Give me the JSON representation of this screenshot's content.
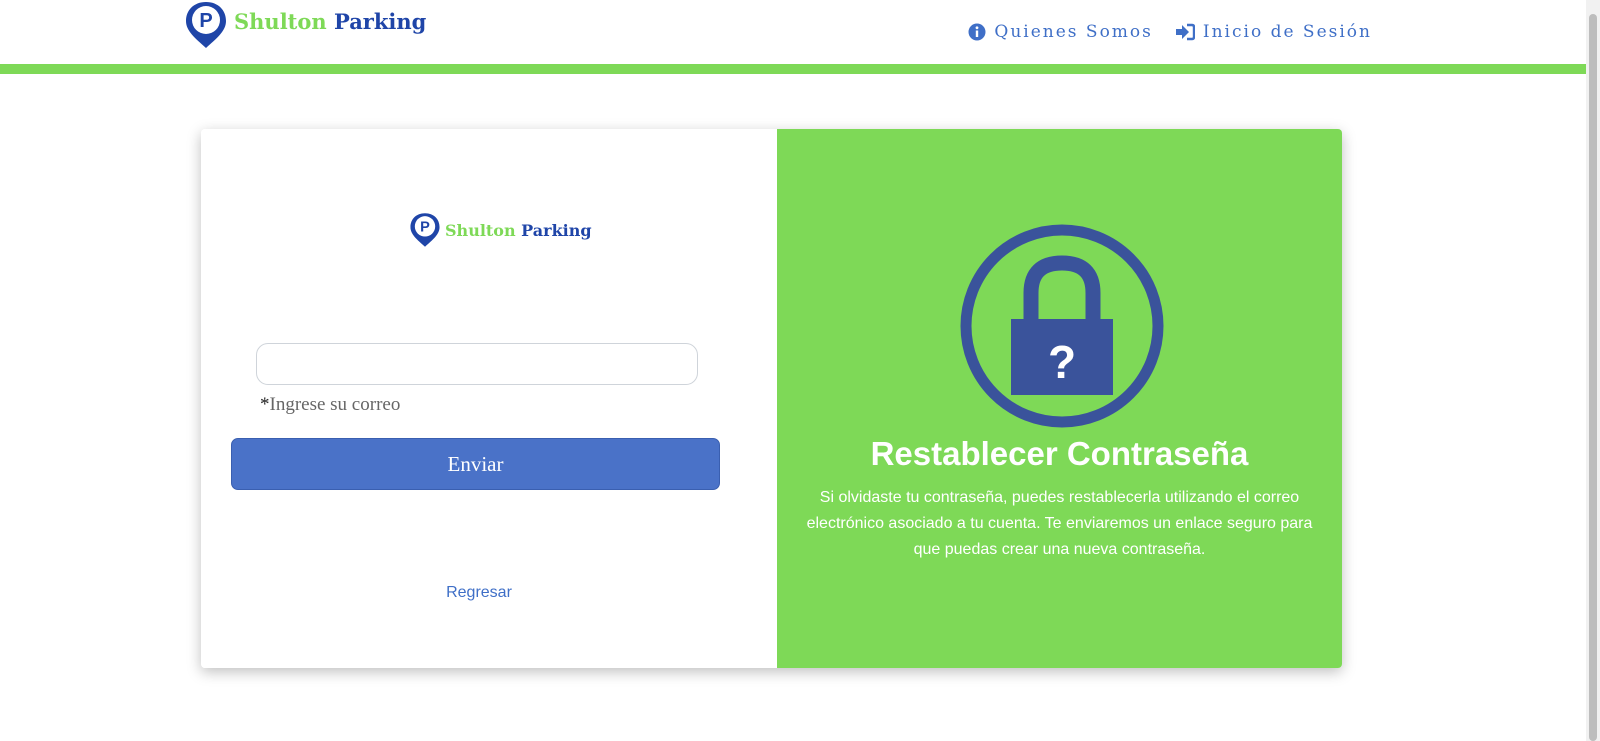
{
  "header": {
    "brand_part1": "Shulton",
    "brand_part2": "Parking",
    "nav": [
      {
        "label": "Quienes Somos",
        "icon": "info-circle-icon"
      },
      {
        "label": "Inicio de Sesión",
        "icon": "sign-in-icon"
      }
    ]
  },
  "colors": {
    "green": "#7ed957",
    "blue": "#1f45a8",
    "button": "#4a72c8",
    "lock": "#3a539b"
  },
  "form": {
    "email_value": "",
    "email_hint_required": "*",
    "email_hint": "Ingrese su correo",
    "send_label": "Enviar",
    "back_label": "Regresar"
  },
  "panel": {
    "title": "Restablecer Contraseña",
    "description": "Si olvidaste tu contraseña, puedes restablecerla utilizando el correo electrónico asociado a tu cuenta. Te enviaremos un enlace seguro para que puedas crear una nueva contraseña.",
    "lock_symbol": "?"
  }
}
